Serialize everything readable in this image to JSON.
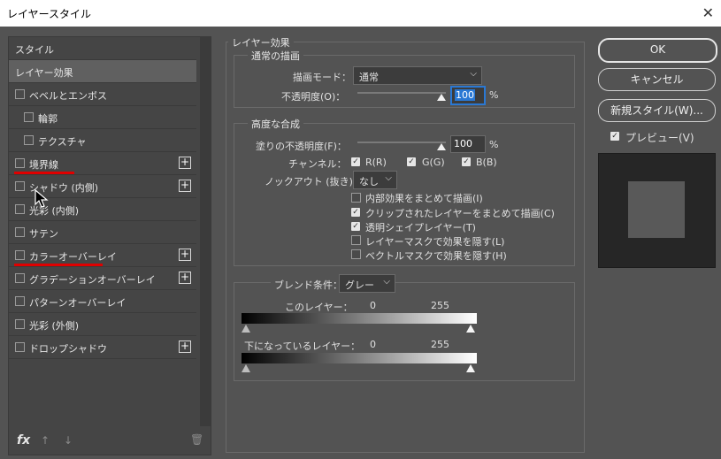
{
  "window": {
    "title": "レイヤースタイル",
    "close_label": "✕"
  },
  "left_panel": {
    "style_header": "スタイル",
    "selected_item": "レイヤー効果",
    "items": [
      {
        "label": "ベベルとエンボス",
        "plus": false
      },
      {
        "label": "輪郭",
        "plus": false
      },
      {
        "label": "テクスチャ",
        "plus": false
      },
      {
        "label": "境界線",
        "plus": true
      },
      {
        "label": "シャドウ (内側)",
        "plus": true
      },
      {
        "label": "光彩 (内側)",
        "plus": false
      },
      {
        "label": "サテン",
        "plus": false
      },
      {
        "label": "カラーオーバーレイ",
        "plus": true
      },
      {
        "label": "グラデーションオーバーレイ",
        "plus": true
      },
      {
        "label": "パターンオーバーレイ",
        "plus": false
      },
      {
        "label": "光彩 (外側)",
        "plus": false
      },
      {
        "label": "ドロップシャドウ",
        "plus": true
      }
    ],
    "footer": {
      "fx": "fx",
      "up": "↑",
      "down": "↓",
      "trash": "🗑"
    }
  },
  "layer_effects": {
    "title": "レイヤー効果",
    "normal": {
      "title": "通常の描画",
      "blend_mode_label": "描画モード：",
      "blend_mode_value": "通常",
      "opacity_label": "不透明度(O)：",
      "opacity_value": "100",
      "opacity_unit": "%"
    },
    "advanced": {
      "title": "高度な合成",
      "fill_opacity_label": "塗りの不透明度(F)：",
      "fill_opacity_value": "100",
      "fill_opacity_unit": "%",
      "channels_label": "チャンネル：",
      "channel_r": "R(R)",
      "channel_g": "G(G)",
      "channel_b": "B(B)",
      "knockout_label": "ノックアウト (抜き)：",
      "knockout_value": "なし",
      "options": [
        {
          "label": "内部効果をまとめて描画(I)",
          "checked": false
        },
        {
          "label": "クリップされたレイヤーをまとめて描画(C)",
          "checked": true
        },
        {
          "label": "透明シェイプレイヤー(T)",
          "checked": true
        },
        {
          "label": "レイヤーマスクで効果を隠す(L)",
          "checked": false
        },
        {
          "label": "ベクトルマスクで効果を隠す(H)",
          "checked": false
        }
      ]
    },
    "blend_if": {
      "label": "ブレンド条件：",
      "value": "グレー",
      "this_layer_label": "このレイヤー：",
      "this_layer_min": "0",
      "this_layer_max": "255",
      "underlying_label": "下になっているレイヤー：",
      "underlying_min": "0",
      "underlying_max": "255"
    }
  },
  "right_panel": {
    "ok": "OK",
    "cancel": "キャンセル",
    "new_style": "新規スタイル(W)...",
    "preview_label": "プレビュー(V)",
    "preview_checked": true
  }
}
